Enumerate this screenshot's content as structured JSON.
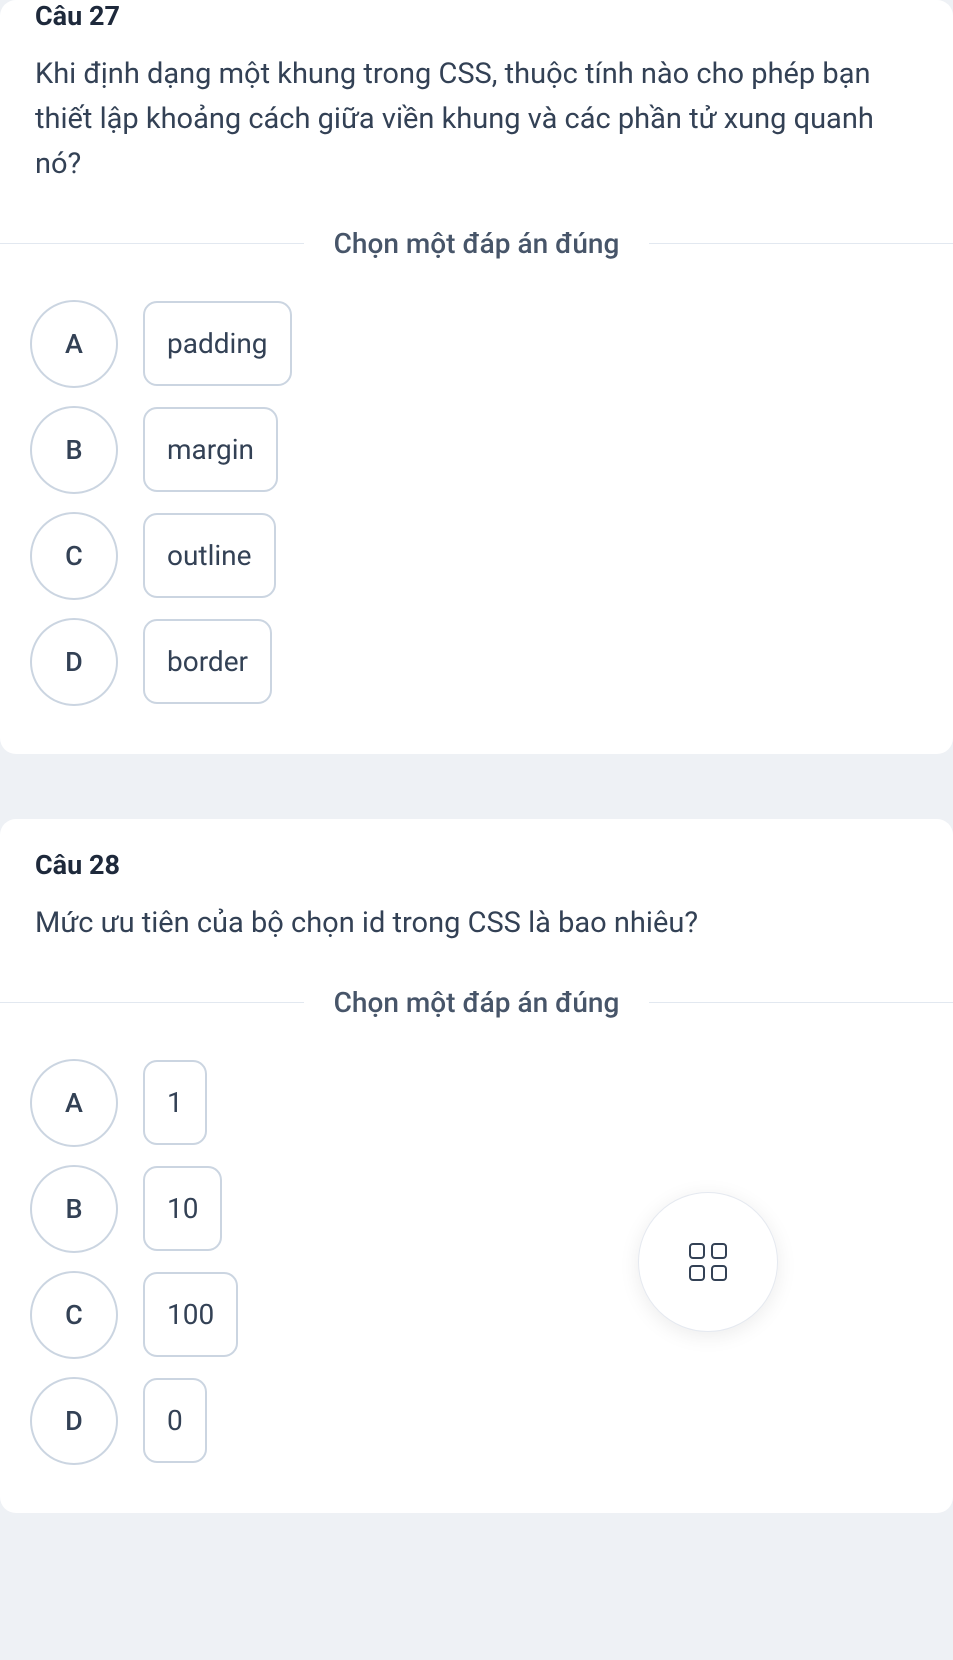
{
  "questions": [
    {
      "title": "Câu 27",
      "text": "Khi định dạng một khung trong CSS, thuộc tính nào cho phép bạn thiết lập khoảng cách giữa viền khung và các phần tử xung quanh nó?",
      "instruction": "Chọn một đáp án đúng",
      "options": [
        {
          "letter": "A",
          "text": "padding"
        },
        {
          "letter": "B",
          "text": "margin"
        },
        {
          "letter": "C",
          "text": "outline"
        },
        {
          "letter": "D",
          "text": "border"
        }
      ]
    },
    {
      "title": "Câu 28",
      "text": "Mức ưu tiên của bộ chọn id trong CSS là bao nhiêu?",
      "instruction": "Chọn một đáp án đúng",
      "options": [
        {
          "letter": "A",
          "text": "1"
        },
        {
          "letter": "B",
          "text": "10"
        },
        {
          "letter": "C",
          "text": "100"
        },
        {
          "letter": "D",
          "text": "0"
        }
      ]
    }
  ]
}
